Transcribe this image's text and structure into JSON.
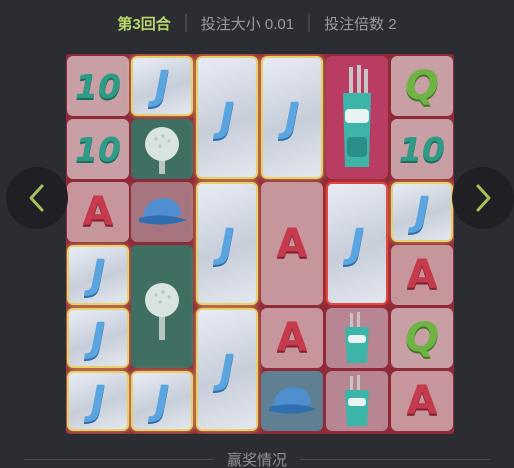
{
  "header": {
    "round_label": "第3回合",
    "bet_size": "投注大小 0.01",
    "bet_multiplier": "投注倍数 2"
  },
  "nav": {
    "prev_icon": "chevron-left-icon",
    "next_icon": "chevron-right-icon",
    "icon_color": "#a4c15a"
  },
  "footer": {
    "section_label": "赢奖情况"
  },
  "reels": [
    [
      {
        "symbol": "10",
        "glyph": "10"
      },
      {
        "symbol": "10",
        "glyph": "10"
      },
      {
        "symbol": "A",
        "glyph": "A"
      },
      {
        "symbol": "J",
        "glyph": "J",
        "highlight": "gold"
      },
      {
        "symbol": "J",
        "glyph": "J",
        "highlight": "gold"
      },
      {
        "symbol": "J",
        "glyph": "J",
        "highlight": "gold"
      }
    ],
    [
      {
        "symbol": "J",
        "glyph": "J",
        "highlight": "gold"
      },
      {
        "symbol": "golf-ball",
        "glyph": ""
      },
      {
        "symbol": "cap",
        "glyph": ""
      },
      {
        "symbol": "golf-ball",
        "glyph": ""
      },
      {
        "symbol": "J",
        "glyph": "J",
        "highlight": "gold"
      }
    ],
    [
      {
        "symbol": "J",
        "glyph": "J",
        "highlight": "gold"
      },
      {
        "symbol": "J",
        "glyph": "J",
        "highlight": "gold"
      },
      {
        "symbol": "J",
        "glyph": "J",
        "highlight": "gold"
      }
    ],
    [
      {
        "symbol": "J",
        "glyph": "J",
        "highlight": "gold"
      },
      {
        "symbol": "A",
        "glyph": "A"
      },
      {
        "symbol": "A",
        "glyph": "A"
      },
      {
        "symbol": "cap",
        "glyph": ""
      }
    ],
    [
      {
        "symbol": "golf-bag",
        "glyph": ""
      },
      {
        "symbol": "J",
        "glyph": "J",
        "highlight": "red"
      },
      {
        "symbol": "golf-bag",
        "glyph": ""
      },
      {
        "symbol": "golf-bag",
        "glyph": ""
      }
    ],
    [
      {
        "symbol": "Q",
        "glyph": "Q"
      },
      {
        "symbol": "10",
        "glyph": "10"
      },
      {
        "symbol": "J",
        "glyph": "J",
        "highlight": "gold"
      },
      {
        "symbol": "A",
        "glyph": "A"
      },
      {
        "symbol": "Q",
        "glyph": "Q"
      },
      {
        "symbol": "A",
        "glyph": "A"
      }
    ]
  ]
}
